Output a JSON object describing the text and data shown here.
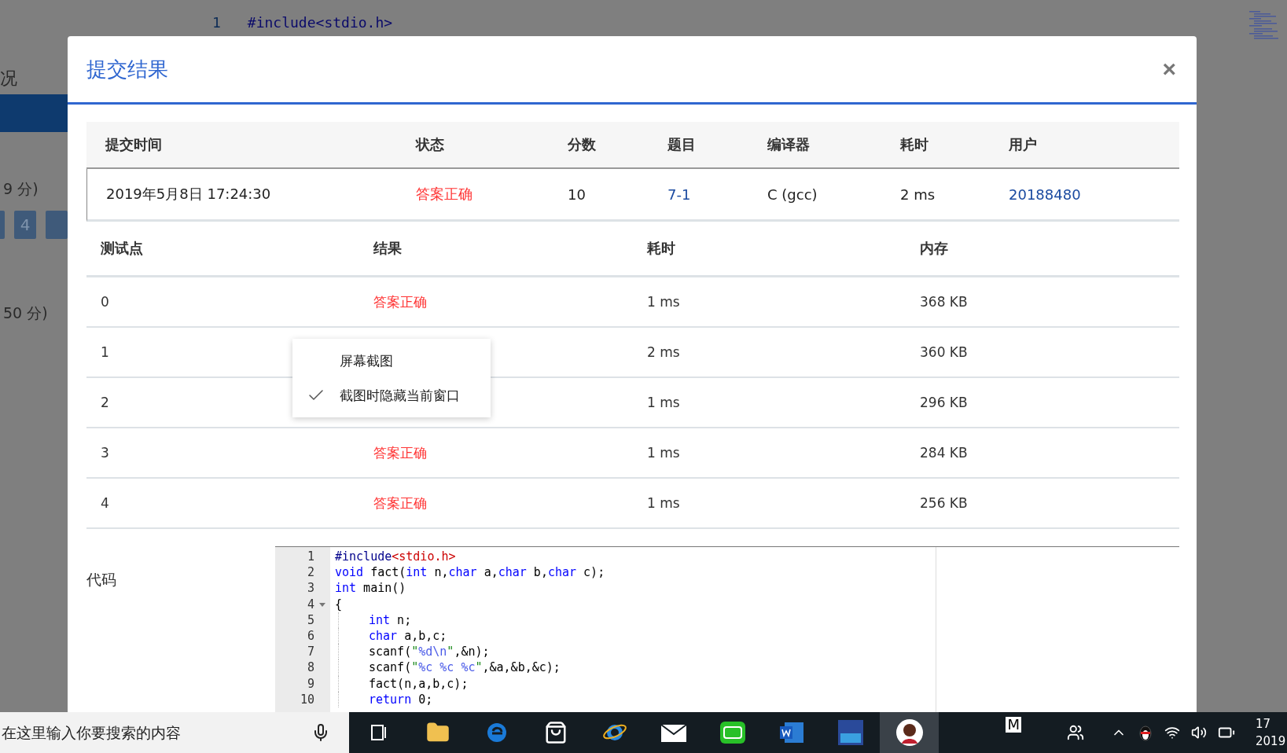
{
  "background": {
    "sidebar": [
      {
        "label": "况",
        "selected": false
      },
      {
        "selected": true
      }
    ],
    "scores": [
      "9 分)",
      "50 分)"
    ],
    "page_buttons": [
      {
        "label": "4"
      }
    ],
    "code_line": {
      "number": "1",
      "text": "#include<stdio.h>"
    }
  },
  "dialog": {
    "title": "提交结果",
    "close": "×",
    "summary": {
      "columns": [
        "提交时间",
        "状态",
        "分数",
        "题目",
        "编译器",
        "耗时",
        "用户"
      ],
      "row": [
        {
          "text": "2019年5月8日 17:24:30",
          "kind": "plain"
        },
        {
          "text": "答案正确",
          "kind": "status"
        },
        {
          "text": "10",
          "kind": "plain"
        },
        {
          "text": "7-1",
          "kind": "link"
        },
        {
          "text": "C (gcc)",
          "kind": "plain"
        },
        {
          "text": "2 ms",
          "kind": "plain"
        },
        {
          "text": "20188480",
          "kind": "link"
        }
      ]
    },
    "tests": {
      "columns": [
        "测试点",
        "结果",
        "耗时",
        "内存"
      ],
      "rows": [
        {
          "point": "0",
          "result": "答案正确",
          "time": "1 ms",
          "memory": "368 KB"
        },
        {
          "point": "1",
          "time": "2 ms",
          "memory": "360 KB"
        },
        {
          "point": "2",
          "time": "1 ms",
          "memory": "296 KB"
        },
        {
          "point": "3",
          "result": "答案正确",
          "time": "1 ms",
          "memory": "284 KB"
        },
        {
          "point": "4",
          "result": "答案正确",
          "time": "1 ms",
          "memory": "256 KB"
        }
      ]
    },
    "code": {
      "label": "代码",
      "lines": [
        {
          "number": "1",
          "indented": false,
          "tokens": [
            {
              "kind": "dir",
              "text": "#include"
            },
            {
              "kind": "hdr",
              "text": "<stdio.h>"
            }
          ]
        },
        {
          "number": "2",
          "indented": false,
          "tokens": [
            {
              "kind": "kw",
              "text": "void"
            },
            {
              "kind": "p",
              "text": " fact("
            },
            {
              "kind": "kw",
              "text": "int"
            },
            {
              "kind": "p",
              "text": " n,"
            },
            {
              "kind": "kw",
              "text": "char"
            },
            {
              "kind": "p",
              "text": " a,"
            },
            {
              "kind": "kw",
              "text": "char"
            },
            {
              "kind": "p",
              "text": " b,"
            },
            {
              "kind": "kw",
              "text": "char"
            },
            {
              "kind": "p",
              "text": " c);"
            }
          ]
        },
        {
          "number": "3",
          "indented": false,
          "tokens": [
            {
              "kind": "kw",
              "text": "int"
            },
            {
              "kind": "p",
              "text": " main()"
            }
          ]
        },
        {
          "number": "4",
          "indented": false,
          "foldable": true,
          "tokens": [
            {
              "kind": "p",
              "text": "{"
            }
          ]
        },
        {
          "number": "5",
          "indented": true,
          "tokens": [
            {
              "kind": "kw",
              "text": "int"
            },
            {
              "kind": "p",
              "text": " n;"
            }
          ]
        },
        {
          "number": "6",
          "indented": true,
          "tokens": [
            {
              "kind": "kw",
              "text": "char"
            },
            {
              "kind": "p",
              "text": " a,b,c;"
            }
          ]
        },
        {
          "number": "7",
          "indented": true,
          "tokens": [
            {
              "kind": "p",
              "text": "scanf("
            },
            {
              "kind": "str",
              "text": "\""
            },
            {
              "kind": "fmt",
              "text": "%d\\n"
            },
            {
              "kind": "str",
              "text": "\""
            },
            {
              "kind": "p",
              "text": ",&n);"
            }
          ]
        },
        {
          "number": "8",
          "indented": true,
          "tokens": [
            {
              "kind": "p",
              "text": "scanf("
            },
            {
              "kind": "str",
              "text": "\""
            },
            {
              "kind": "fmt",
              "text": "%c %c %c"
            },
            {
              "kind": "str",
              "text": "\""
            },
            {
              "kind": "p",
              "text": ",&a,&b,&c);"
            }
          ]
        },
        {
          "number": "9",
          "indented": true,
          "tokens": [
            {
              "kind": "p",
              "text": "fact(n,a,b,c);"
            }
          ]
        },
        {
          "number": "10",
          "indented": true,
          "tokens": [
            {
              "kind": "kw",
              "text": "return"
            },
            {
              "kind": "p",
              "text": " 0;"
            }
          ]
        }
      ]
    }
  },
  "context_menu": {
    "items": [
      {
        "label": "屏幕截图",
        "checked": false
      },
      {
        "label": "截图时隐藏当前窗口",
        "checked": true
      }
    ]
  },
  "taskbar": {
    "search": {
      "placeholder": "在这里输入你要搜索的内容"
    },
    "apps": [
      {
        "kind": "taskview",
        "selected": false
      },
      {
        "kind": "folder",
        "selected": false
      },
      {
        "kind": "edge",
        "selected": false
      },
      {
        "kind": "store",
        "selected": false
      },
      {
        "kind": "ie",
        "selected": false
      },
      {
        "kind": "mail",
        "selected": false
      },
      {
        "kind": "video",
        "selected": false
      },
      {
        "kind": "word",
        "selected": false
      },
      {
        "kind": "ide",
        "selected": false
      },
      {
        "kind": "avatar",
        "selected": true
      }
    ],
    "tray_letter": "M",
    "clock": [
      "17",
      "2019"
    ]
  }
}
